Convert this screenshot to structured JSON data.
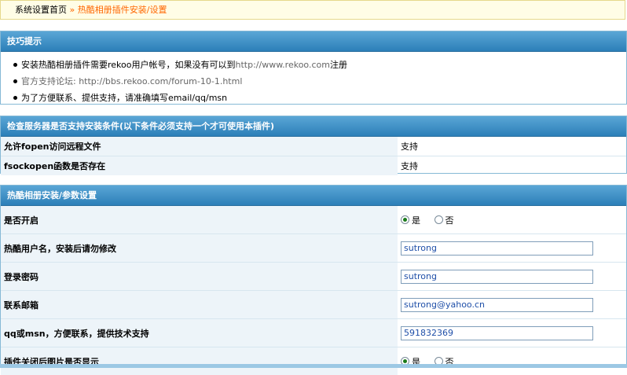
{
  "breadcrumb": {
    "home": "系统设置首页",
    "separator": "»",
    "current": "热酷相册插件安装/设置"
  },
  "tips": {
    "title": "技巧提示",
    "items": [
      {
        "prefix": "安装热酷相册插件需要rekoo用户帐号，如果没有可以到",
        "link": "http://www.rekoo.com",
        "suffix": "注册"
      },
      {
        "text": "官方支持论坛: http://bbs.rekoo.com/forum-10-1.html"
      },
      {
        "text": "为了方便联系、提供支持，请准确填写email/qq/msn"
      }
    ]
  },
  "check": {
    "title": "检查服务器是否支持安装条件(以下条件必须支持一个才可使用本插件)",
    "rows": [
      {
        "label": "允许fopen访问远程文件",
        "value": "支持"
      },
      {
        "label": "fsockopen函数是否存在",
        "value": "支持"
      }
    ]
  },
  "settings": {
    "title": "热酷相册安装/参数设置",
    "enable": {
      "label": "是否开启",
      "yes": "是",
      "no": "否",
      "selected": "yes"
    },
    "username": {
      "label": "热酷用户名，安装后请勿修改",
      "value": "sutrong"
    },
    "password": {
      "label": "登录密码",
      "value": "sutrong"
    },
    "email": {
      "label": "联系邮箱",
      "value": "sutrong@yahoo.cn"
    },
    "qqmsn": {
      "label": "qq或msn，方便联系，提供技术支持",
      "value": "591832369"
    },
    "show_images": {
      "label": "插件关闭后图片是否显示",
      "yes": "是",
      "no": "否",
      "selected": "yes"
    }
  }
}
